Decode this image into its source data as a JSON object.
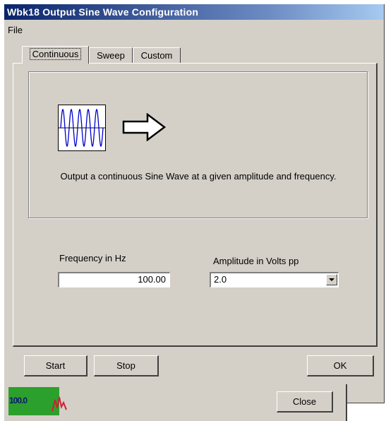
{
  "window": {
    "title": "Wbk18 Output Sine Wave Configuration"
  },
  "menu": {
    "file_label": "File"
  },
  "tabs": [
    {
      "label": "Continuous",
      "active": true
    },
    {
      "label": "Sweep",
      "active": false
    },
    {
      "label": "Custom",
      "active": false
    }
  ],
  "panel": {
    "description": "Output a continuous Sine Wave at a given amplitude and frequency.",
    "wave_icon": "sine-wave-icon",
    "arrow_icon": "right-arrow-icon"
  },
  "frequency": {
    "label": "Frequency in Hz",
    "value": "100.00"
  },
  "amplitude": {
    "label": "Amplitude in Volts pp",
    "selected": "2.0"
  },
  "buttons": {
    "start": "Start",
    "stop": "Stop",
    "ok": "OK",
    "close": "Close"
  },
  "status": {
    "readout": "100.0"
  },
  "colors": {
    "title_bar": "#0a246a",
    "face": "#d4d0c8",
    "wave": "#0000cc",
    "status_green": "#2ca02c"
  }
}
